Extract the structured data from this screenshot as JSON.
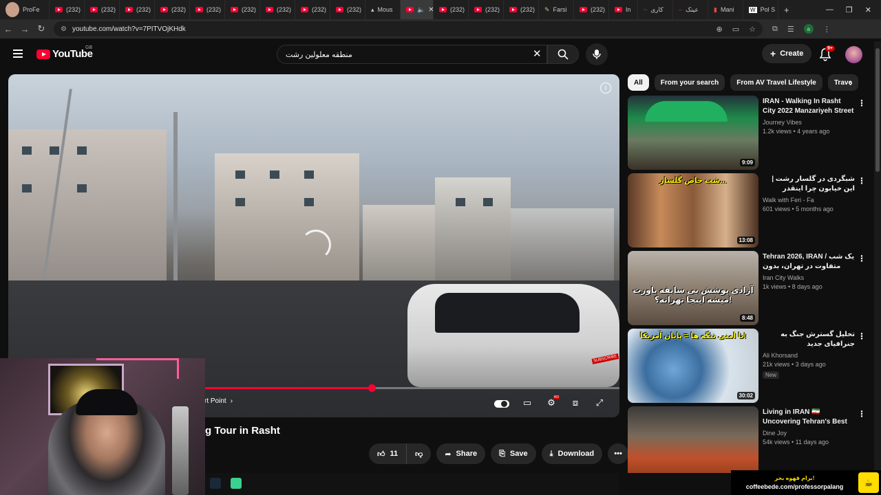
{
  "browser": {
    "tabs": [
      {
        "label": "ProFe"
      },
      {
        "label": "(232)"
      },
      {
        "label": "(232)"
      },
      {
        "label": "(232)"
      },
      {
        "label": "(232)"
      },
      {
        "label": "(232)"
      },
      {
        "label": "(232)"
      },
      {
        "label": "(232)"
      },
      {
        "label": "(232)"
      },
      {
        "label": "(232)"
      },
      {
        "label": "Mous"
      },
      {
        "label": ""
      },
      {
        "label": "(232)"
      },
      {
        "label": "(232)"
      },
      {
        "label": "(232)"
      },
      {
        "label": "Farsi"
      },
      {
        "label": "(232)"
      },
      {
        "label": "In"
      },
      {
        "label": "کاری"
      },
      {
        "label": "عینک"
      },
      {
        "label": "Mani"
      },
      {
        "label": "Pol S"
      }
    ],
    "new_tab_glyph": "+",
    "url": "youtube.com/watch?v=7PITVOjKHdk",
    "profile_initial": "a"
  },
  "header": {
    "logo_text": "YouTube",
    "country_code": "GB",
    "search_query": "منطقه معلولین رشت",
    "create_label": "Create",
    "notification_count": "9+"
  },
  "player": {
    "chapter_label": "rt Point",
    "progress_fraction": 0.595,
    "subscribe_watermark": "SUBSCRIBE"
  },
  "video": {
    "title": "g Tour in Rasht",
    "like_count": "11",
    "share_label": "Share",
    "save_label": "Save",
    "download_label": "Download"
  },
  "chips": [
    {
      "label": "All",
      "active": true
    },
    {
      "label": "From your search"
    },
    {
      "label": "From AV Travel Lifestyle"
    },
    {
      "label": "Trave"
    }
  ],
  "recommendations": [
    {
      "title": "IRAN - Walking In Rasht City 2022 Manzariyeh Street Ira...",
      "channel": "Journey Vibes",
      "stats": "1.2k views • 4 years ago",
      "duration": "9:09",
      "thumb_text": ""
    },
    {
      "title": "شبگردی در گلسار رشت | این خیابون چرا اینقدر وسوسه‌انگیزه؟",
      "channel": "Walk with Feri - Fa",
      "stats": "601 views • 5 months ago",
      "duration": "13:08",
      "thumb_text": "شب خاص گلسار..."
    },
    {
      "title": "Tehran 2026, IRAN / یک شب متفاوت در تهران، بدون سانسور!!",
      "channel": "Iran City Walks",
      "stats": "1k views • 8 days ago",
      "duration": "8:48",
      "thumb_text": "آزادی پوشش بی سابقه باورت میشه اینجا تهرانه؟!"
    },
    {
      "title": "تحلیل گسترش جنگ به جنرافیای جدید",
      "channel": "Ali Khorsand",
      "stats": "21k views • 3 days ago",
      "duration": "30:02",
      "badge": "New",
      "thumb_text": "نا امنی تنگه ها = پایان آمریکا!"
    },
    {
      "title": "Living in IRAN 🇮🇷 Uncovering Tehran's Best Street Food ...",
      "channel": "Dine Joy",
      "stats": "54k views • 11 days ago",
      "duration": "",
      "thumb_text": ""
    }
  ],
  "overlay": {
    "coffee_line1": "برام قهوه بخر!",
    "coffee_line2": "coffeebede.com/professorpalang"
  },
  "colors": {
    "accent": "#ff0033",
    "background": "#0f0f0f",
    "chip": "#272727"
  }
}
